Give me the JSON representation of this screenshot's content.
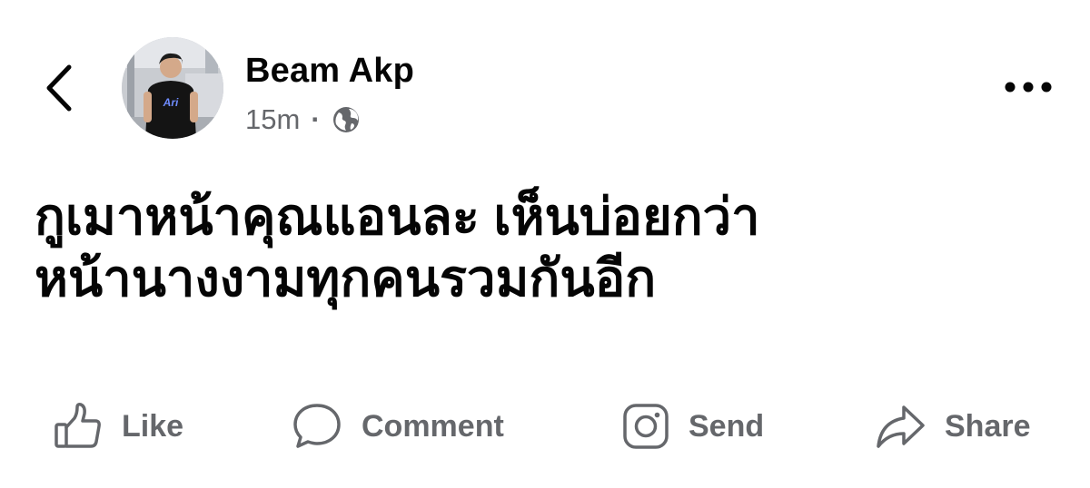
{
  "header": {
    "back_icon": "chevron-left-icon",
    "author_name": "Beam Akp",
    "timestamp": "15m",
    "separator": "·",
    "privacy_icon": "globe-icon",
    "more_icon": "more-horizontal-icon",
    "avatar_shirt_text": "Ari"
  },
  "post": {
    "line1": "กูเมาหน้าคุณแอนละ เห็นบ่อยกว่า",
    "line2": "หน้านางงามทุกคนรวมกันอีก"
  },
  "actions": [
    {
      "label": "Like",
      "icon": "thumbs-up-icon"
    },
    {
      "label": "Comment",
      "icon": "speech-bubble-icon"
    },
    {
      "label": "Send",
      "icon": "instagram-icon"
    },
    {
      "label": "Share",
      "icon": "share-arrow-icon"
    }
  ],
  "colors": {
    "text_primary": "#050505",
    "text_secondary": "#65676b",
    "background": "#ffffff"
  }
}
